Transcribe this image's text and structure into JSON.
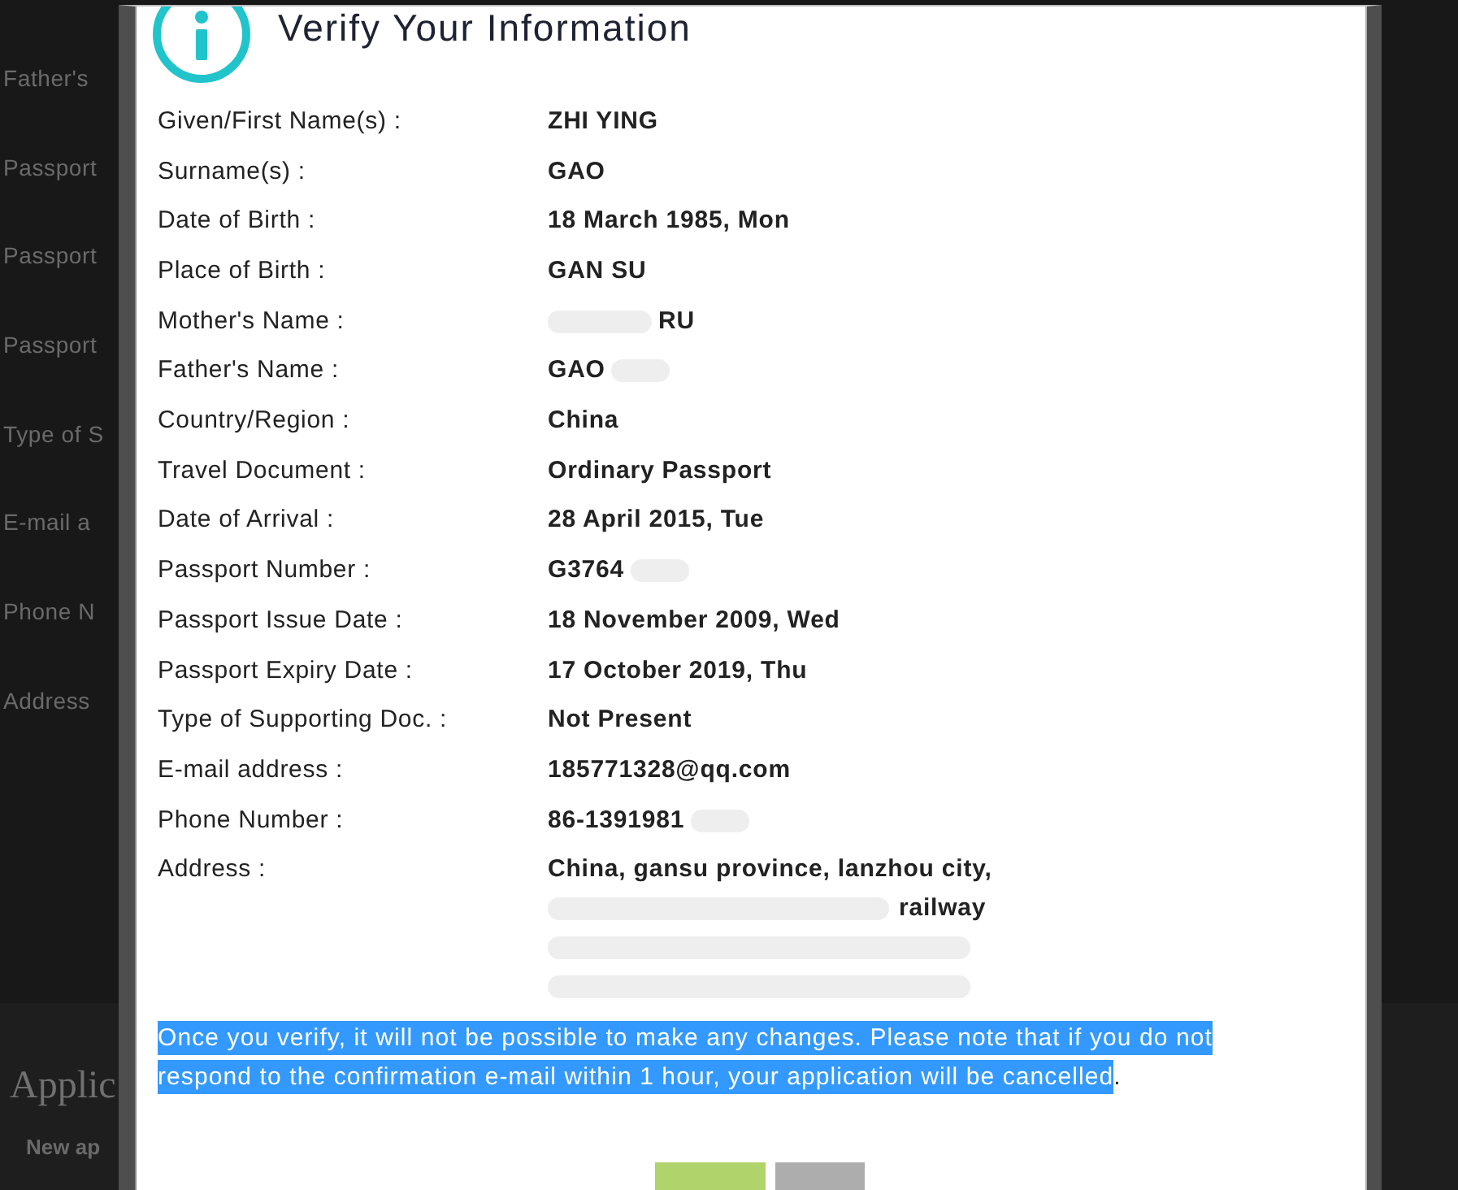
{
  "background_page": {
    "form_labels": [
      "Father's",
      "Passport",
      "Passport",
      "Passport",
      "Type of S",
      "E-mail a",
      "Phone N",
      "Address"
    ],
    "section_title": "Applic",
    "section_subtitle": "New ap"
  },
  "dialog": {
    "title": "Verify Your Information",
    "fields": [
      {
        "kind": "plain",
        "label": "Given/First Name(s) :",
        "value": "ZHI YING"
      },
      {
        "kind": "plain",
        "label": "Surname(s) :",
        "value": "GAO"
      },
      {
        "kind": "plain",
        "label": "Date of Birth :",
        "value": "18 March 1985, Mon"
      },
      {
        "kind": "plain",
        "label": "Place of Birth :",
        "value": "GAN SU"
      },
      {
        "kind": "masked_start",
        "label": "Mother's Name :",
        "value": "RU"
      },
      {
        "kind": "masked_end",
        "label": "Father's Name :",
        "value": "GAO"
      },
      {
        "kind": "plain",
        "label": "Country/Region :",
        "value": "China"
      },
      {
        "kind": "plain",
        "label": "Travel Document :",
        "value": "Ordinary Passport"
      },
      {
        "kind": "plain",
        "label": "Date of Arrival :",
        "value": "28 April 2015, Tue"
      },
      {
        "kind": "masked_end",
        "label": "Passport Number :",
        "value": "G3764"
      },
      {
        "kind": "plain",
        "label": "Passport Issue Date :",
        "value": "18 November 2009, Wed"
      },
      {
        "kind": "plain",
        "label": "Passport Expiry Date :",
        "value": "17 October 2019, Thu"
      },
      {
        "kind": "plain",
        "label": "Type of Supporting Doc. :",
        "value": "Not Present"
      },
      {
        "kind": "plain",
        "label": "E-mail address :",
        "value": "185771328@qq.com"
      },
      {
        "kind": "masked_end",
        "label": "Phone Number :",
        "value": "86-1391981"
      },
      {
        "kind": "multiline",
        "label": "Address :",
        "lines": [
          {
            "kind": "plain",
            "value": "China, gansu province, lanzhou city,"
          },
          {
            "kind": "masked_start",
            "value": "railway"
          },
          {
            "kind": "masked"
          },
          {
            "kind": "masked"
          }
        ]
      }
    ],
    "notice": {
      "text": "Once you verify, it will not be possible to make any changes. Please note that if you do not respond to the confirmation e-mail within 1 hour, your application will be cancelled",
      "tail": ".",
      "selected": true
    },
    "buttons": [
      {
        "kind": "primary"
      },
      {
        "kind": "secondary"
      }
    ]
  }
}
